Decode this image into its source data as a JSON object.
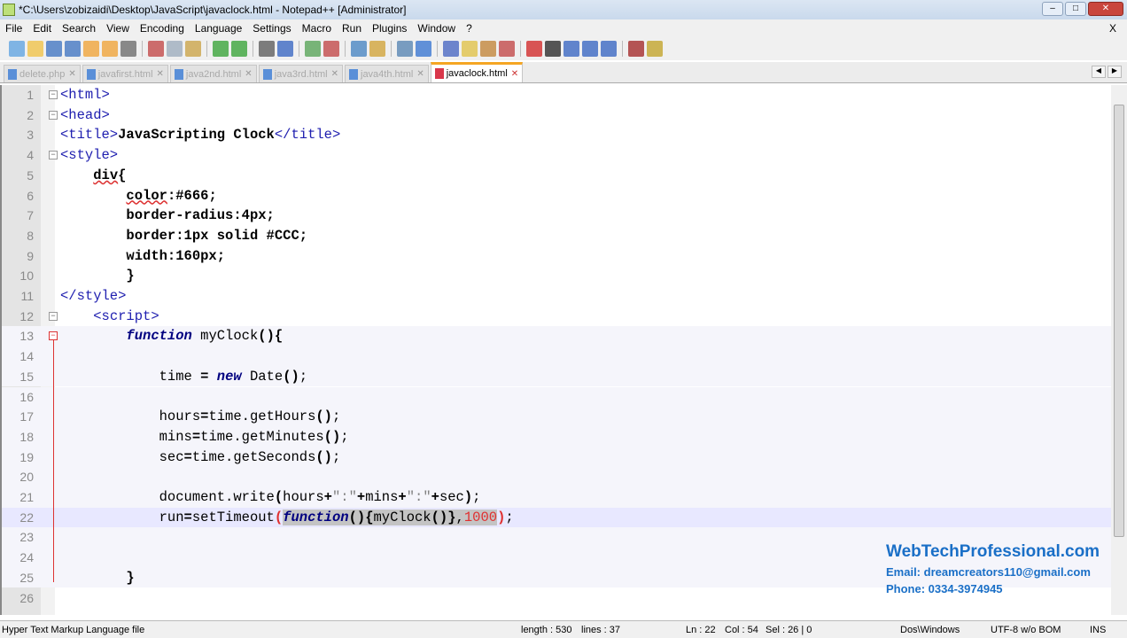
{
  "window": {
    "title": "*C:\\Users\\zobizaidi\\Desktop\\JavaScript\\javaclock.html - Notepad++ [Administrator]",
    "minimize": "–",
    "maximize": "□",
    "close": "✕"
  },
  "menu": [
    "File",
    "Edit",
    "Search",
    "View",
    "Encoding",
    "Language",
    "Settings",
    "Macro",
    "Run",
    "Plugins",
    "Window",
    "?"
  ],
  "menu_close": "X",
  "toolbar": {
    "icons": [
      "new-file",
      "open-file",
      "save",
      "save-all",
      "close",
      "close-all",
      "print",
      "cut",
      "copy",
      "paste",
      "undo",
      "redo",
      "find",
      "replace",
      "zoom-in",
      "zoom-out",
      "sync-v",
      "sync-h",
      "word-wrap",
      "show-all-chars",
      "indent-guide",
      "user-lang",
      "doc-map",
      "function-list",
      "record-macro",
      "stop-macro",
      "play-macro",
      "run-macro-multiple",
      "save-macro",
      "spell-check",
      "extra"
    ],
    "colors": [
      "#5aa0e0",
      "#f0c040",
      "#3a70c0",
      "#3a70c0",
      "#f0a030",
      "#f0a030",
      "#666666",
      "#c04040",
      "#9ab",
      "#c9a040",
      "#30a030",
      "#30a030",
      "#555555",
      "#3060c0",
      "#50a050",
      "#c04040",
      "#4080c0",
      "#d0a030",
      "#5080b0",
      "#3070d0",
      "#4060c0",
      "#e0c040",
      "#c08030",
      "#c04040",
      "#d02020",
      "#222222",
      "#3060c0",
      "#3060c0",
      "#3060c0",
      "#a02020",
      "#c0a020"
    ]
  },
  "tabs": [
    {
      "label": "delete.php",
      "active": false
    },
    {
      "label": "javafirst.html",
      "active": false
    },
    {
      "label": "java2nd.html",
      "active": false
    },
    {
      "label": "java3rd.html",
      "active": false
    },
    {
      "label": "java4th.html",
      "active": false
    },
    {
      "label": "javaclock.html",
      "active": true
    }
  ],
  "editor": {
    "current_line": 22,
    "lines": [
      {
        "n": "1",
        "fold": "box",
        "tokens": [
          [
            "tag",
            "<html>"
          ]
        ]
      },
      {
        "n": "2",
        "fold": "box",
        "tokens": [
          [
            "tag",
            "<head>"
          ]
        ]
      },
      {
        "n": "3",
        "tokens": [
          [
            "tag",
            "<title>"
          ],
          [
            "bold",
            "JavaScripting Clock"
          ],
          [
            "tag",
            "</title>"
          ]
        ]
      },
      {
        "n": "4",
        "fold": "box",
        "tokens": [
          [
            "tag",
            "<style>"
          ]
        ]
      },
      {
        "n": "5",
        "tokens": [
          [
            "",
            "    "
          ],
          [
            "bold wavy",
            "div"
          ],
          [
            "bold",
            "{"
          ]
        ]
      },
      {
        "n": "6",
        "tokens": [
          [
            "",
            "        "
          ],
          [
            "bold wavy",
            "color"
          ],
          [
            "bold",
            ":#666;"
          ]
        ]
      },
      {
        "n": "7",
        "tokens": [
          [
            "",
            "        "
          ],
          [
            "bold",
            "border-radius:4px;"
          ]
        ]
      },
      {
        "n": "8",
        "tokens": [
          [
            "",
            "        "
          ],
          [
            "bold",
            "border:1px solid #CCC;"
          ]
        ]
      },
      {
        "n": "9",
        "tokens": [
          [
            "",
            "        "
          ],
          [
            "bold",
            "width:160px;"
          ]
        ]
      },
      {
        "n": "10",
        "tokens": [
          [
            "",
            "        "
          ],
          [
            "bold",
            "}"
          ]
        ]
      },
      {
        "n": "11",
        "tokens": [
          [
            "tag",
            "</style>"
          ]
        ]
      },
      {
        "n": "12",
        "fold": "box",
        "tokens": [
          [
            "",
            "    "
          ],
          [
            "tag",
            "<script>"
          ]
        ]
      },
      {
        "n": "13",
        "fold": "red",
        "block": true,
        "tokens": [
          [
            "",
            "        "
          ],
          [
            "kw",
            "function"
          ],
          [
            "",
            " myClock"
          ],
          [
            "op",
            "(){"
          ]
        ]
      },
      {
        "n": "14",
        "block": true,
        "tokens": []
      },
      {
        "n": "15",
        "block": true,
        "tokens": [
          [
            "",
            "            time "
          ],
          [
            "op",
            "="
          ],
          [
            "",
            " "
          ],
          [
            "kw",
            "new"
          ],
          [
            "",
            " Date"
          ],
          [
            "op",
            "()"
          ],
          [
            "",
            ";"
          ]
        ]
      },
      {
        "n": "16",
        "block": true,
        "tokens": []
      },
      {
        "n": "17",
        "block": true,
        "tokens": [
          [
            "",
            "            hours"
          ],
          [
            "op",
            "="
          ],
          [
            "",
            "time.getHours"
          ],
          [
            "op",
            "()"
          ],
          [
            "",
            ";"
          ]
        ]
      },
      {
        "n": "18",
        "block": true,
        "tokens": [
          [
            "",
            "            mins"
          ],
          [
            "op",
            "="
          ],
          [
            "",
            "time.getMinutes"
          ],
          [
            "op",
            "()"
          ],
          [
            "",
            ";"
          ]
        ]
      },
      {
        "n": "19",
        "block": true,
        "tokens": [
          [
            "",
            "            sec"
          ],
          [
            "op",
            "="
          ],
          [
            "",
            "time.getSeconds"
          ],
          [
            "op",
            "()"
          ],
          [
            "",
            ";"
          ]
        ]
      },
      {
        "n": "20",
        "block": true,
        "tokens": []
      },
      {
        "n": "21",
        "block": true,
        "tokens": [
          [
            "",
            "            document.write"
          ],
          [
            "op",
            "("
          ],
          [
            "",
            "hours"
          ],
          [
            "op",
            "+"
          ],
          [
            "str",
            "\":\""
          ],
          [
            "op",
            "+"
          ],
          [
            "",
            "mins"
          ],
          [
            "op",
            "+"
          ],
          [
            "str",
            "\":\""
          ],
          [
            "op",
            "+"
          ],
          [
            "",
            "sec"
          ],
          [
            "op",
            ")"
          ],
          [
            "",
            ";"
          ]
        ]
      },
      {
        "n": "22",
        "block": true,
        "tokens": [
          [
            "",
            "            run"
          ],
          [
            "op",
            "="
          ],
          [
            "",
            "setTimeout"
          ],
          [
            "num2 op",
            "("
          ],
          [
            "kw sel",
            "function"
          ],
          [
            "op sel",
            "(){"
          ],
          [
            "sel",
            "myClock"
          ],
          [
            "op sel",
            "()}"
          ],
          [
            "sel",
            ","
          ],
          [
            "num2 sel",
            "1000"
          ],
          [
            "num2 op",
            ")"
          ],
          [
            "",
            ";"
          ]
        ]
      },
      {
        "n": "23",
        "block": true,
        "tokens": []
      },
      {
        "n": "24",
        "block": true,
        "tokens": []
      },
      {
        "n": "25",
        "block": true,
        "tokens": [
          [
            "",
            "        "
          ],
          [
            "op",
            "}"
          ]
        ]
      },
      {
        "n": "26",
        "tokens": []
      }
    ]
  },
  "watermark": {
    "site": "WebTechProfessional.com",
    "email": "Email: dreamcreators110@gmail.com",
    "phone": "Phone: 0334-3974945"
  },
  "status": {
    "filetype": "Hyper Text Markup Language file",
    "length": "length : 530",
    "lines": "lines : 37",
    "ln": "Ln : 22",
    "col": "Col : 54",
    "sel": "Sel : 26 | 0",
    "eol": "Dos\\Windows",
    "encoding": "UTF-8 w/o BOM",
    "mode": "INS"
  }
}
